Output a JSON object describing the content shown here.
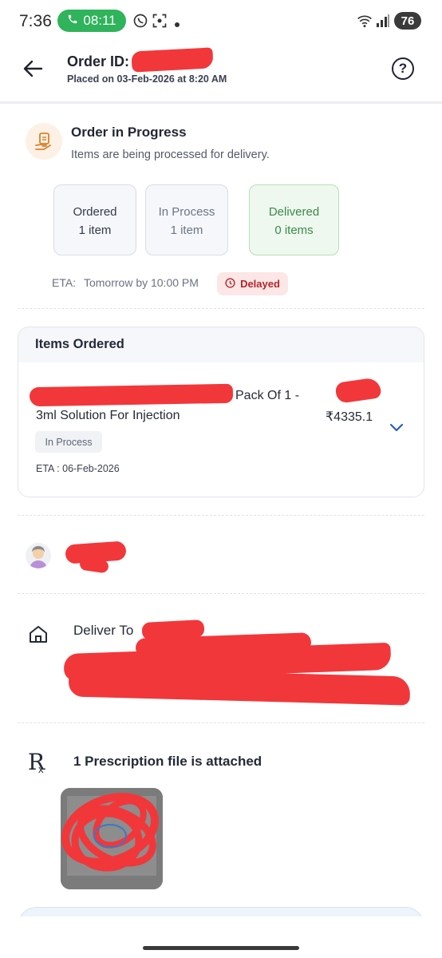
{
  "status_bar": {
    "time": "7:36",
    "call_time": "08:11",
    "battery": "76"
  },
  "header": {
    "order_id_label": "Order ID:",
    "placed_on": "Placed on 03-Feb-2026 at 8:20 AM"
  },
  "progress": {
    "title": "Order in Progress",
    "subtitle": "Items are being processed for delivery.",
    "stats": [
      {
        "label": "Ordered",
        "count": "1 item"
      },
      {
        "label": "In Process",
        "count": "1 item"
      },
      {
        "label": "Delivered",
        "count": "0 items"
      }
    ],
    "eta_label": "ETA:",
    "eta_value": "Tomorrow by 10:00 PM",
    "delay_badge": "Delayed"
  },
  "items": {
    "heading": "Items Ordered",
    "list": [
      {
        "name": "Pack Of 1 - 3ml Solution For Injection",
        "price": "₹4335.1",
        "status": "In Process",
        "eta": "ETA : 06-Feb-2026"
      }
    ]
  },
  "delivery": {
    "label": "Deliver To"
  },
  "prescription": {
    "label": "1 Prescription file is attached"
  },
  "colors": {
    "delivered_green": "#3b8a4a",
    "delayed_red": "#b3262b",
    "accent_blue": "#2563b8"
  }
}
